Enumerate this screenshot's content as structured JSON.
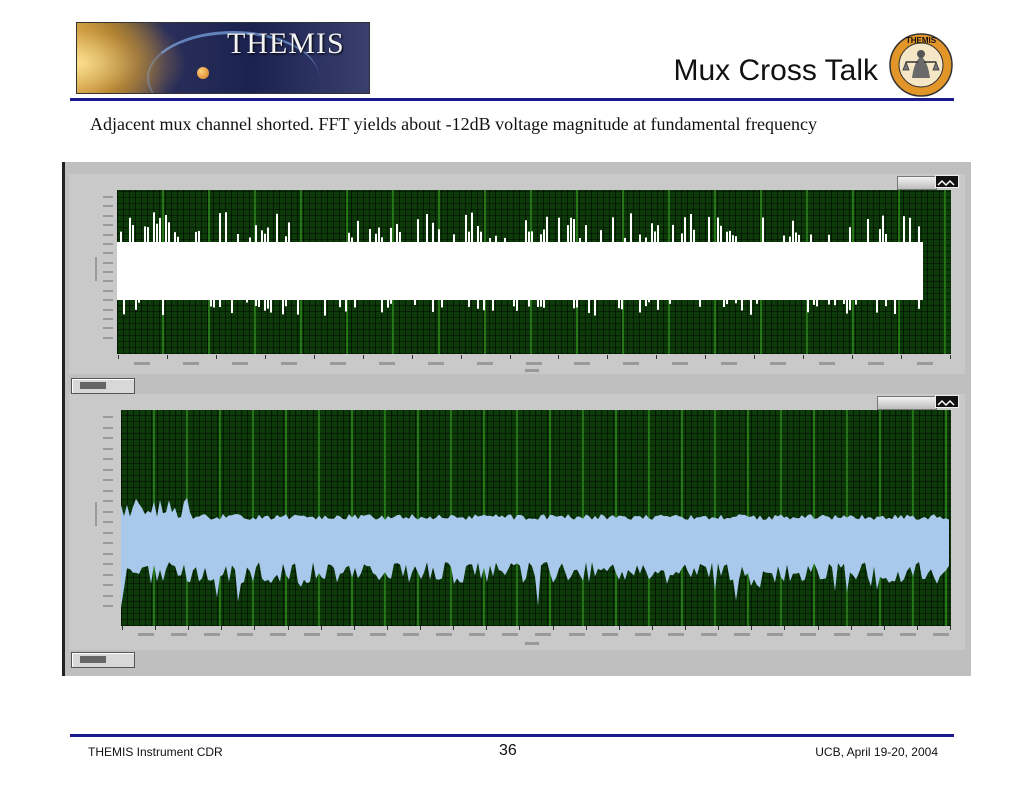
{
  "header": {
    "banner_text": "THEMIS",
    "slide_title": "Mux Cross Talk",
    "seal_text": "THEMIS"
  },
  "caption": "Adjacent mux channel shorted. FFT yields about -12dB voltage magnitude at fundamental frequency",
  "colors": {
    "rule": "#1a1a8c",
    "plot_bg": "#0c3a08",
    "plot_grid": "#2e8a1e",
    "trace_top": "#ffffff",
    "trace_bottom": "#a9c9ec",
    "window_gray": "#c9c9c9"
  },
  "footer": {
    "left": "THEMIS Instrument CDR",
    "page_number": "36",
    "right": "UCB, April 19-20, 2004"
  }
}
